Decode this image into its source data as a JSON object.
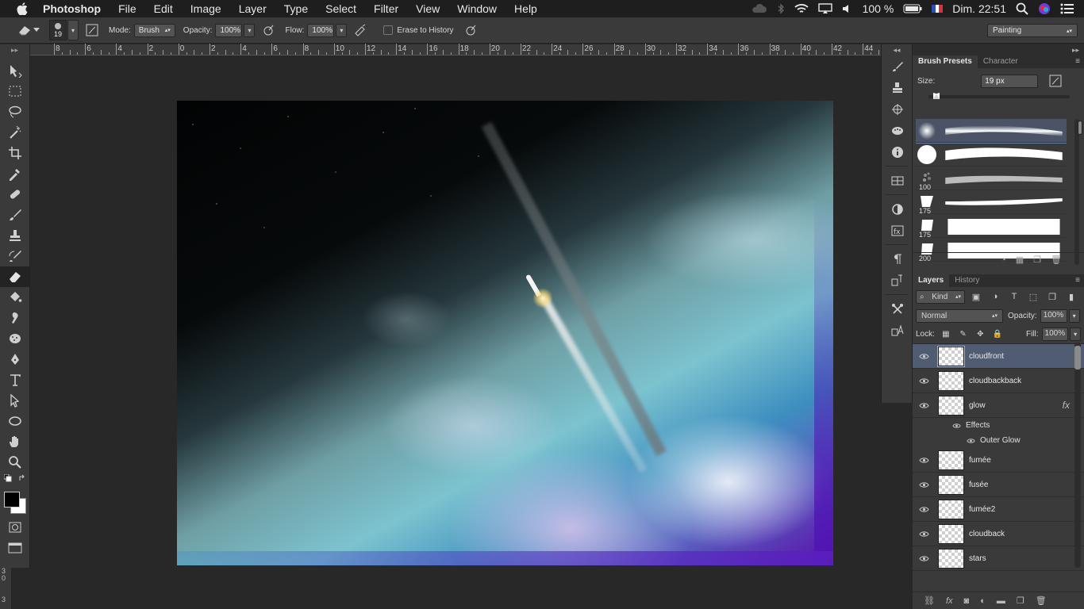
{
  "menubar": {
    "app_name": "Photoshop",
    "items": [
      "File",
      "Edit",
      "Image",
      "Layer",
      "Type",
      "Select",
      "Filter",
      "View",
      "Window",
      "Help"
    ],
    "battery": "100 %",
    "clock": "Dim. 22:51"
  },
  "options": {
    "brush_size": "19",
    "mode_label": "Mode:",
    "mode_value": "Brush",
    "opacity_label": "Opacity:",
    "opacity_value": "100%",
    "flow_label": "Flow:",
    "flow_value": "100%",
    "erase_history_label": "Erase to History",
    "workspace": "Painting"
  },
  "ruler": {
    "ticks": [
      "8",
      "6",
      "4",
      "2",
      "0",
      "2",
      "4",
      "6",
      "8",
      "10",
      "12",
      "14",
      "16",
      "18",
      "20",
      "22",
      "24",
      "26",
      "28",
      "30",
      "32",
      "34",
      "36",
      "38",
      "40",
      "42",
      "44"
    ],
    "left_label": "3\n0\n3"
  },
  "tools": [
    "move-tool",
    "marquee-tool",
    "lasso-tool",
    "magic-wand-tool",
    "crop-tool",
    "eyedropper-tool",
    "healing-brush-tool",
    "brush-tool",
    "clone-stamp-tool",
    "history-brush-tool",
    "eraser-tool",
    "paint-bucket-tool",
    "blur-tool",
    "dodge-tool",
    "pen-tool",
    "type-tool",
    "path-selection-tool",
    "ellipse-tool",
    "hand-tool",
    "zoom-tool"
  ],
  "brush_panel": {
    "tabs": [
      "Brush Presets",
      "Character"
    ],
    "size_label": "Size:",
    "size_value": "19 px",
    "presets": [
      {
        "size": "",
        "kind": "soft"
      },
      {
        "size": "",
        "kind": "hard"
      },
      {
        "size": "100",
        "kind": "spatter"
      },
      {
        "size": "175",
        "kind": "chalk"
      },
      {
        "size": "175",
        "kind": "flat"
      },
      {
        "size": "200",
        "kind": "flat2"
      }
    ]
  },
  "layers_panel": {
    "tabs": [
      "Layers",
      "History"
    ],
    "kind_label": "Kind",
    "blend_mode": "Normal",
    "opacity_label": "Opacity:",
    "opacity_value": "100%",
    "lock_label": "Lock:",
    "fill_label": "Fill:",
    "fill_value": "100%",
    "layers": [
      {
        "name": "cloudfront",
        "selected": true
      },
      {
        "name": "cloudbackback",
        "selected": false
      },
      {
        "name": "glow",
        "selected": false,
        "fx": "fx"
      },
      {
        "name": "fumée",
        "selected": false
      },
      {
        "name": "fusée",
        "selected": false
      },
      {
        "name": "fumée2",
        "selected": false
      },
      {
        "name": "cloudback",
        "selected": false
      },
      {
        "name": "stars",
        "selected": false
      }
    ],
    "effects_label": "Effects",
    "outer_glow_label": "Outer Glow"
  }
}
